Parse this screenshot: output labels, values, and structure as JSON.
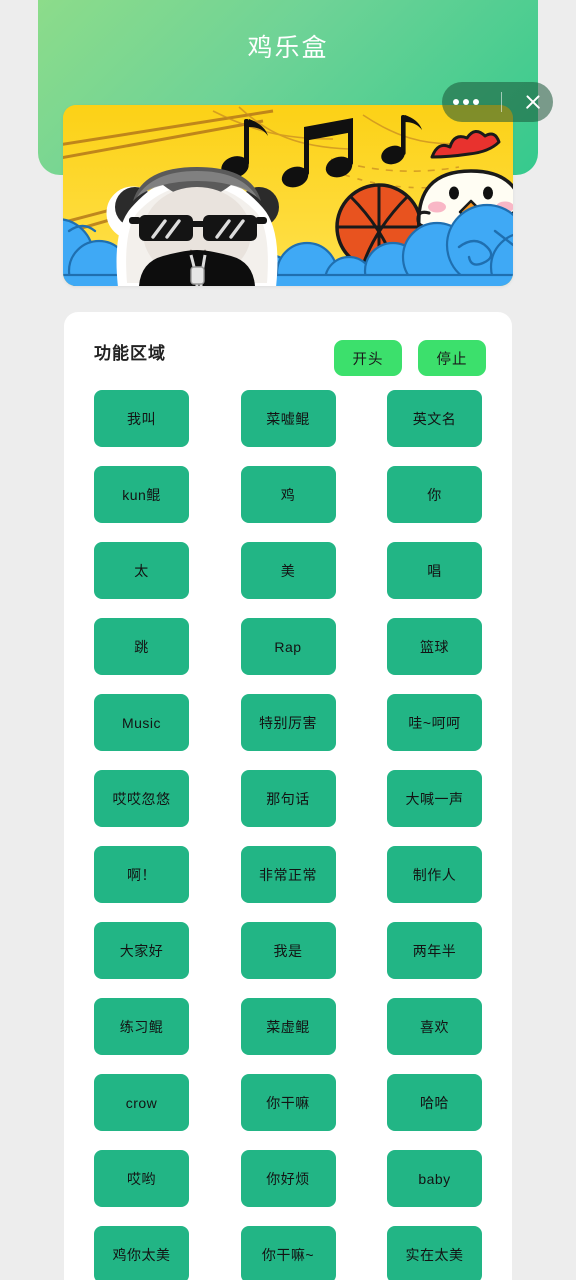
{
  "header": {
    "title": "鸡乐盒",
    "capsule": {
      "more_icon": "more-dots-icon",
      "close_icon": "close-icon"
    },
    "gradient_from": "#8ddc8a",
    "gradient_to": "#35c98d"
  },
  "banner": {
    "alt": "鸡你太美 banner with panda meme, music notes, basketball and chicken",
    "background_color": "#f8d521",
    "wave_color": "#3fa9f5"
  },
  "main": {
    "section_title": "功能区域",
    "actions": [
      {
        "label": "开头",
        "name": "start-button"
      },
      {
        "label": "停止",
        "name": "stop-button"
      }
    ],
    "accent_action_color": "#3ce06c",
    "accent_grid_color": "#22b585",
    "buttons": [
      "我叫",
      "菜嘘鲲",
      "英文名",
      "kun鲲",
      "鸡",
      "你",
      "太",
      "美",
      "唱",
      "跳",
      "Rap",
      "篮球",
      "Music",
      "特别厉害",
      "哇~呵呵",
      "哎哎忽悠",
      "那句话",
      "大喊一声",
      "啊！",
      "非常正常",
      "制作人",
      "大家好",
      "我是",
      "两年半",
      "练习鲲",
      "菜虚鲲",
      "喜欢",
      "crow",
      "你干嘛",
      "哈哈",
      "哎哟",
      "你好烦",
      "baby",
      "鸡你太美",
      "你干嘛~",
      "实在太美"
    ]
  }
}
